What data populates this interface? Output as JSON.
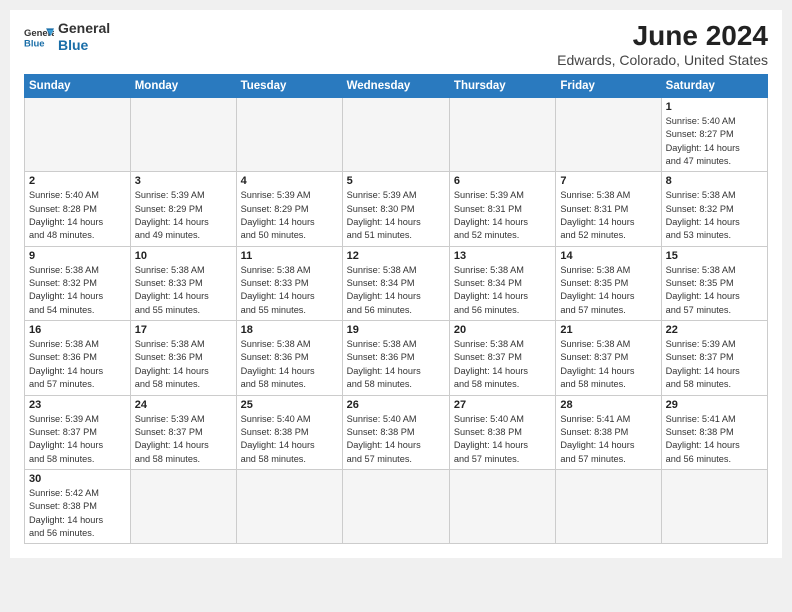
{
  "header": {
    "logo_line1": "General",
    "logo_line2": "Blue",
    "month_year": "June 2024",
    "location": "Edwards, Colorado, United States"
  },
  "weekdays": [
    "Sunday",
    "Monday",
    "Tuesday",
    "Wednesday",
    "Thursday",
    "Friday",
    "Saturday"
  ],
  "weeks": [
    [
      {
        "day": "",
        "info": ""
      },
      {
        "day": "",
        "info": ""
      },
      {
        "day": "",
        "info": ""
      },
      {
        "day": "",
        "info": ""
      },
      {
        "day": "",
        "info": ""
      },
      {
        "day": "",
        "info": ""
      },
      {
        "day": "1",
        "info": "Sunrise: 5:40 AM\nSunset: 8:27 PM\nDaylight: 14 hours\nand 47 minutes."
      }
    ],
    [
      {
        "day": "2",
        "info": "Sunrise: 5:40 AM\nSunset: 8:28 PM\nDaylight: 14 hours\nand 48 minutes."
      },
      {
        "day": "3",
        "info": "Sunrise: 5:39 AM\nSunset: 8:29 PM\nDaylight: 14 hours\nand 49 minutes."
      },
      {
        "day": "4",
        "info": "Sunrise: 5:39 AM\nSunset: 8:29 PM\nDaylight: 14 hours\nand 50 minutes."
      },
      {
        "day": "5",
        "info": "Sunrise: 5:39 AM\nSunset: 8:30 PM\nDaylight: 14 hours\nand 51 minutes."
      },
      {
        "day": "6",
        "info": "Sunrise: 5:39 AM\nSunset: 8:31 PM\nDaylight: 14 hours\nand 52 minutes."
      },
      {
        "day": "7",
        "info": "Sunrise: 5:38 AM\nSunset: 8:31 PM\nDaylight: 14 hours\nand 52 minutes."
      },
      {
        "day": "8",
        "info": "Sunrise: 5:38 AM\nSunset: 8:32 PM\nDaylight: 14 hours\nand 53 minutes."
      }
    ],
    [
      {
        "day": "9",
        "info": "Sunrise: 5:38 AM\nSunset: 8:32 PM\nDaylight: 14 hours\nand 54 minutes."
      },
      {
        "day": "10",
        "info": "Sunrise: 5:38 AM\nSunset: 8:33 PM\nDaylight: 14 hours\nand 55 minutes."
      },
      {
        "day": "11",
        "info": "Sunrise: 5:38 AM\nSunset: 8:33 PM\nDaylight: 14 hours\nand 55 minutes."
      },
      {
        "day": "12",
        "info": "Sunrise: 5:38 AM\nSunset: 8:34 PM\nDaylight: 14 hours\nand 56 minutes."
      },
      {
        "day": "13",
        "info": "Sunrise: 5:38 AM\nSunset: 8:34 PM\nDaylight: 14 hours\nand 56 minutes."
      },
      {
        "day": "14",
        "info": "Sunrise: 5:38 AM\nSunset: 8:35 PM\nDaylight: 14 hours\nand 57 minutes."
      },
      {
        "day": "15",
        "info": "Sunrise: 5:38 AM\nSunset: 8:35 PM\nDaylight: 14 hours\nand 57 minutes."
      }
    ],
    [
      {
        "day": "16",
        "info": "Sunrise: 5:38 AM\nSunset: 8:36 PM\nDaylight: 14 hours\nand 57 minutes."
      },
      {
        "day": "17",
        "info": "Sunrise: 5:38 AM\nSunset: 8:36 PM\nDaylight: 14 hours\nand 58 minutes."
      },
      {
        "day": "18",
        "info": "Sunrise: 5:38 AM\nSunset: 8:36 PM\nDaylight: 14 hours\nand 58 minutes."
      },
      {
        "day": "19",
        "info": "Sunrise: 5:38 AM\nSunset: 8:36 PM\nDaylight: 14 hours\nand 58 minutes."
      },
      {
        "day": "20",
        "info": "Sunrise: 5:38 AM\nSunset: 8:37 PM\nDaylight: 14 hours\nand 58 minutes."
      },
      {
        "day": "21",
        "info": "Sunrise: 5:38 AM\nSunset: 8:37 PM\nDaylight: 14 hours\nand 58 minutes."
      },
      {
        "day": "22",
        "info": "Sunrise: 5:39 AM\nSunset: 8:37 PM\nDaylight: 14 hours\nand 58 minutes."
      }
    ],
    [
      {
        "day": "23",
        "info": "Sunrise: 5:39 AM\nSunset: 8:37 PM\nDaylight: 14 hours\nand 58 minutes."
      },
      {
        "day": "24",
        "info": "Sunrise: 5:39 AM\nSunset: 8:37 PM\nDaylight: 14 hours\nand 58 minutes."
      },
      {
        "day": "25",
        "info": "Sunrise: 5:40 AM\nSunset: 8:38 PM\nDaylight: 14 hours\nand 58 minutes."
      },
      {
        "day": "26",
        "info": "Sunrise: 5:40 AM\nSunset: 8:38 PM\nDaylight: 14 hours\nand 57 minutes."
      },
      {
        "day": "27",
        "info": "Sunrise: 5:40 AM\nSunset: 8:38 PM\nDaylight: 14 hours\nand 57 minutes."
      },
      {
        "day": "28",
        "info": "Sunrise: 5:41 AM\nSunset: 8:38 PM\nDaylight: 14 hours\nand 57 minutes."
      },
      {
        "day": "29",
        "info": "Sunrise: 5:41 AM\nSunset: 8:38 PM\nDaylight: 14 hours\nand 56 minutes."
      }
    ],
    [
      {
        "day": "30",
        "info": "Sunrise: 5:42 AM\nSunset: 8:38 PM\nDaylight: 14 hours\nand 56 minutes."
      },
      {
        "day": "",
        "info": ""
      },
      {
        "day": "",
        "info": ""
      },
      {
        "day": "",
        "info": ""
      },
      {
        "day": "",
        "info": ""
      },
      {
        "day": "",
        "info": ""
      },
      {
        "day": "",
        "info": ""
      }
    ]
  ]
}
